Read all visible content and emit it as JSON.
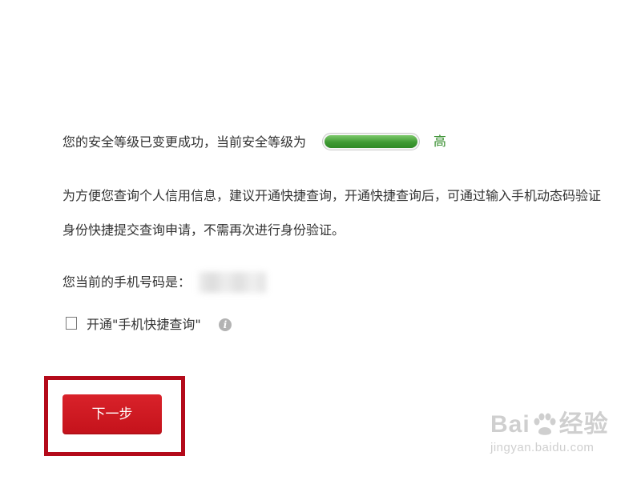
{
  "security": {
    "status_text": "您的安全等级已变更成功，当前安全等级为",
    "level_label": "高",
    "level_fraction": 1.0,
    "level_color": "#3f9a33",
    "level_text_color": "#2f8a26"
  },
  "info": {
    "line1": "为方便您查询个人信用信息，建议开通快捷查询，开通快捷查询后，可通过输入手机动态码验证",
    "line2": "身份快捷提交查询申请，不需再次进行身份验证。"
  },
  "phone": {
    "label": "您当前的手机号码是："
  },
  "quick_query": {
    "label": "开通\"手机快捷查询\"",
    "checked": false,
    "info_icon": "info-icon",
    "info_glyph": "i"
  },
  "next_button": {
    "label": "下一步",
    "color": "#c4121b",
    "highlight_color": "#b40a1a"
  },
  "watermark": {
    "brand_left": "Bai",
    "brand_right": "经验",
    "url": "jingyan.baidu.com"
  }
}
